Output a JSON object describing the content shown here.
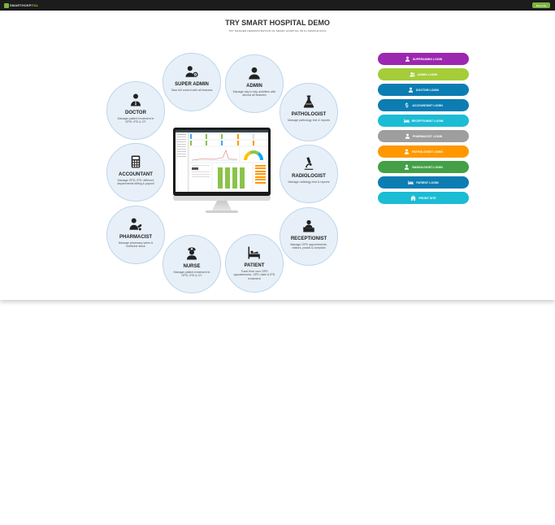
{
  "topbar": {
    "brand_left": "SMARTHOSP",
    "brand_right": "ITAL",
    "buy_label": "Buy now"
  },
  "header": {
    "title": "TRY SMART HOSPITAL DEMO",
    "subtitle": "TRY MANGED DEMONSTRATION OF SMART HOSPITAL WITH SAMPLE DATA"
  },
  "roles": [
    {
      "key": "super-admin",
      "icon": "user-gear-icon",
      "name": "SUPER ADMIN",
      "desc": "Take full control with all features"
    },
    {
      "key": "admin",
      "icon": "user-icon",
      "name": "ADMIN",
      "desc": "Manage day to day activities with almost all features"
    },
    {
      "key": "doctor",
      "icon": "doctor-icon",
      "name": "DOCTOR",
      "desc": "Manage patient treatment in OPD, IPD & OT"
    },
    {
      "key": "pathologist",
      "icon": "flask-icon",
      "name": "PATHOLOGIST",
      "desc": "Manage pathology test & reports"
    },
    {
      "key": "accountant",
      "icon": "calculator-icon",
      "name": "ACCOUNTANT",
      "desc": "Manage OPD, IPD, different departments billing & payroll"
    },
    {
      "key": "radiologist",
      "icon": "microscope-icon",
      "name": "RADIOLOGIST",
      "desc": "Manage radiology test & reports"
    },
    {
      "key": "pharmacist",
      "icon": "pharmacist-icon",
      "name": "PHARMACIST",
      "desc": "Manage pharmacy sales & medicine stock"
    },
    {
      "key": "receptionist",
      "icon": "receptionist-icon",
      "name": "RECEPTIONIST",
      "desc": "Manage OPD appointments, visitors, postal & complain"
    },
    {
      "key": "nurse",
      "icon": "nurse-icon",
      "name": "NURSE",
      "desc": "Manage patient treatment in OPD, IPD & OT"
    },
    {
      "key": "patient",
      "icon": "patient-bed-icon",
      "name": "PATIENT",
      "desc": "Track their own OPD appointments, OPD visits & IPD treatment"
    }
  ],
  "logins": [
    {
      "key": "superadmin",
      "label": "SUPERADMIN LOGIN",
      "color": "#9c27b0",
      "icon": "user-icon"
    },
    {
      "key": "admin",
      "label": "ADMIN LOGIN",
      "color": "#a4cd39",
      "icon": "users-icon"
    },
    {
      "key": "doctor",
      "label": "DOCTOR LOGIN",
      "color": "#0b7db3",
      "icon": "user-icon"
    },
    {
      "key": "accountant",
      "label": "ACCOUNTANT LOGIN",
      "color": "#0b7db3",
      "icon": "dollar-icon"
    },
    {
      "key": "receptionist",
      "label": "RECEPTIONIST LOGIN",
      "color": "#1bbcd4",
      "icon": "bed-icon"
    },
    {
      "key": "pharmacist",
      "label": "PHARMACIST LOGIN",
      "color": "#9e9e9e",
      "icon": "user-icon"
    },
    {
      "key": "pathologist",
      "label": "PATHOLOGIST LOGIN",
      "color": "#ff9800",
      "icon": "user-icon"
    },
    {
      "key": "radiologist",
      "label": "RADIOLOGIST LOGIN",
      "color": "#43a047",
      "icon": "user-icon"
    },
    {
      "key": "patient",
      "label": "PATIENT LOGIN",
      "color": "#0b7db3",
      "icon": "bed-icon"
    },
    {
      "key": "front-site",
      "label": "FRONT SITE",
      "color": "#1bbcd4",
      "icon": "hospital-icon"
    }
  ],
  "dashboard_preview": {
    "stat_colors": [
      "#3fa9f5",
      "#8bc34a",
      "#8bc34a",
      "#ff9800",
      "#e0e0e0"
    ],
    "bar_color": "#8bc34a",
    "gauge_colors": [
      "#ffc107",
      "#8bc34a",
      "#03a9f4"
    ]
  }
}
